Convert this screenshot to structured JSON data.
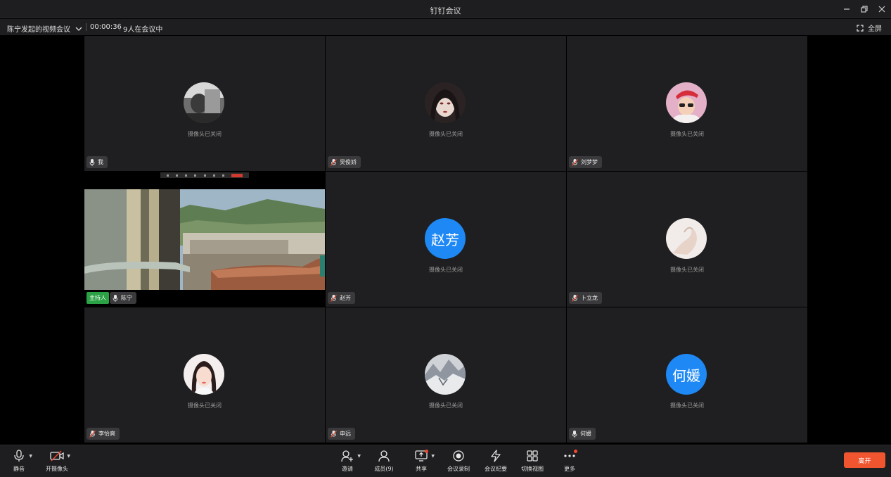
{
  "window": {
    "title": "钉钉会议"
  },
  "info": {
    "meeting_name": "陈宁发起的视频会议",
    "timer": "00:00:36",
    "participant_count": "9人在会议中",
    "fullscreen_label": "全屏"
  },
  "camera_off_text": "摄像头已关闭",
  "tiles": [
    {
      "name": "我",
      "avatar_text": "",
      "mic": "on"
    },
    {
      "name": "吴俊娇",
      "avatar_text": "",
      "mic": "muted"
    },
    {
      "name": "刘梦梦",
      "avatar_text": "",
      "mic": "muted"
    },
    {
      "name": "陈宁",
      "host_label": "主持人",
      "mic": "on",
      "video": true
    },
    {
      "name": "赵芳",
      "avatar_text": "赵芳",
      "mic": "muted"
    },
    {
      "name": "卜立龙",
      "avatar_text": "",
      "mic": "muted"
    },
    {
      "name": "李怡爽",
      "avatar_text": "",
      "mic": "muted"
    },
    {
      "name": "申远",
      "avatar_text": "",
      "mic": "muted"
    },
    {
      "name": "何媛",
      "avatar_text": "何媛",
      "mic": "on"
    }
  ],
  "toolbar": {
    "mute": "静音",
    "camera": "开摄像头",
    "invite": "邀请",
    "members": "成员(9)",
    "share": "共享",
    "record": "会议录制",
    "minutes": "会议纪要",
    "switch_view": "切换视图",
    "more": "更多",
    "leave": "离开"
  },
  "colors": {
    "accent": "#1e88f5",
    "leave": "#f0552f",
    "host": "#2ba245",
    "notify": "#f04a32"
  }
}
